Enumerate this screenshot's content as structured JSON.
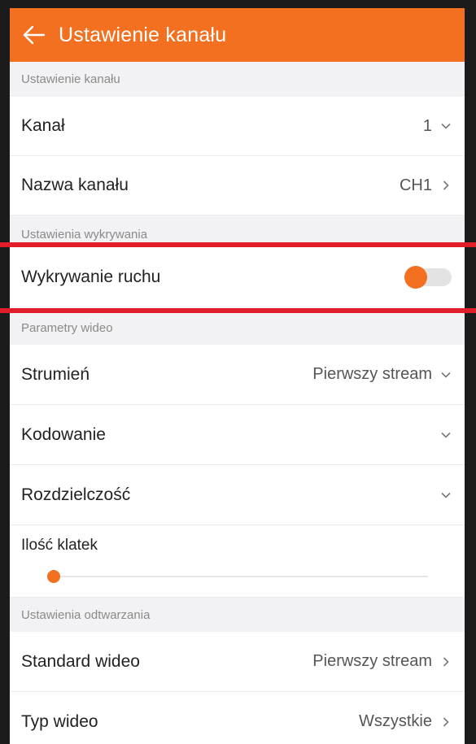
{
  "appbar": {
    "title": "Ustawienie kanału",
    "back_icon": "arrow-left-icon"
  },
  "sections": {
    "channel_header": "Ustawienie kanału",
    "detection_header": "Ustawienia wykrywania",
    "video_header": "Parametry wideo",
    "playback_header": "Ustawienia odtwarzania"
  },
  "channel": {
    "label": "Kanał",
    "value": "1"
  },
  "channel_name": {
    "label": "Nazwa kanału",
    "value": "CH1"
  },
  "motion": {
    "label": "Wykrywanie ruchu",
    "enabled": false
  },
  "stream": {
    "label": "Strumień",
    "value": "Pierwszy stream"
  },
  "encoding": {
    "label": "Kodowanie",
    "value": ""
  },
  "resolution": {
    "label": "Rozdzielczość",
    "value": ""
  },
  "framerate": {
    "label": "Ilość klatek",
    "level": 0
  },
  "video_standard": {
    "label": "Standard wideo",
    "value": "Pierwszy stream"
  },
  "video_type": {
    "label": "Typ wideo",
    "value": "Wszystkie"
  },
  "colors": {
    "accent": "#f37021",
    "highlight": "#e11d2a"
  }
}
